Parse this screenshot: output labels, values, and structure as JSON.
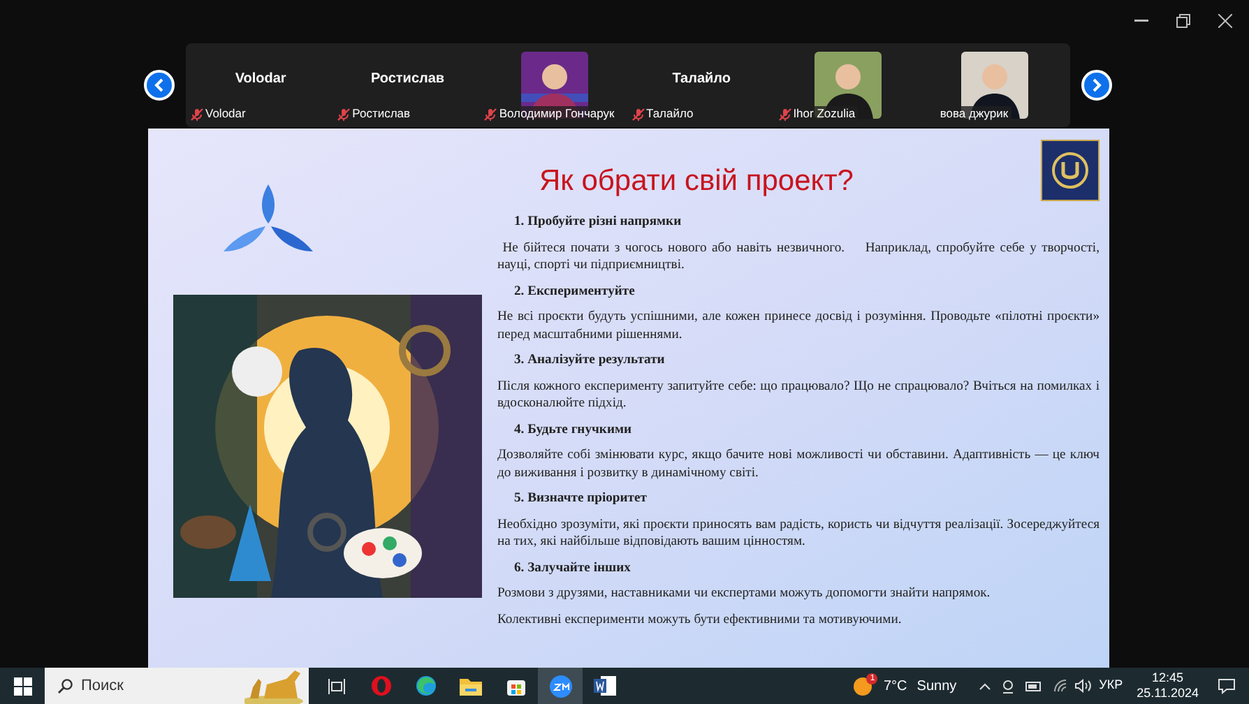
{
  "participants": [
    {
      "kind": "name",
      "display_name": "Volodar",
      "label": "Volodar",
      "muted": true
    },
    {
      "kind": "name",
      "display_name": "Ростислав",
      "label": "Ростислав",
      "muted": true
    },
    {
      "kind": "video",
      "label": "Володимир Гончарук",
      "muted": true
    },
    {
      "kind": "name",
      "display_name": "Талайло",
      "label": "Талайло",
      "muted": true
    },
    {
      "kind": "video",
      "label": "Ihor Zozulia",
      "muted": true
    },
    {
      "kind": "video",
      "label": "вова джурик",
      "muted": false
    }
  ],
  "slide": {
    "title": "Як обрати свій проект?",
    "sections": [
      {
        "heading": "1. Пробуйте різні напрямки",
        "paragraphs": [
          " Не бійтеся почати з чогось нового або навіть незвичного.    Наприклад, спробуйте себе у творчості, науці, спорті чи підприємництві."
        ]
      },
      {
        "heading": "2. Експериментуйте",
        "paragraphs": [
          "Не всі проєкти будуть успішними, але кожен принесе досвід і розуміння. Проводьте «пілотні проєкти» перед масштабними рішеннями."
        ]
      },
      {
        "heading": "3. Аналізуйте результати",
        "paragraphs": [
          "Після кожного експерименту запитуйте себе: що працювало? Що не спрацювало? Вчіться на помилках і вдосконалюйте підхід."
        ]
      },
      {
        "heading": "4. Будьте гнучкими",
        "paragraphs": [
          "Дозволяйте собі змінювати курс, якщо бачите нові можливості чи обставини. Адаптивність — це ключ до виживання і розвитку в динамічному світі."
        ]
      },
      {
        "heading": "5. Визначте пріоритет",
        "paragraphs": [
          "Необхідно зрозуміти, які проєкти приносять вам радість, користь чи відчуття реалізації. Зосереджуйтеся на тих, які найбільше відповідають вашим цінностям."
        ]
      },
      {
        "heading": "6. Залучайте інших",
        "paragraphs": [
          "Розмови з друзями, наставниками чи експертами можуть допомогти знайти напрямок.",
          "Колективні експерименти можуть бути ефективними та мотивуючими."
        ]
      }
    ]
  },
  "taskbar": {
    "search_placeholder": "Поиск",
    "apps": [
      {
        "kind": "taskview",
        "selected": false
      },
      {
        "kind": "opera",
        "selected": false
      },
      {
        "kind": "edge",
        "selected": false
      },
      {
        "kind": "folder",
        "selected": false
      },
      {
        "kind": "store",
        "selected": false
      },
      {
        "kind": "zoom",
        "selected": true
      },
      {
        "kind": "word",
        "selected": false
      }
    ],
    "weather_badge": "1",
    "temperature": "7°C",
    "weather": "Sunny",
    "language": "УКР",
    "time": "12:45",
    "date": "25.11.2024"
  }
}
